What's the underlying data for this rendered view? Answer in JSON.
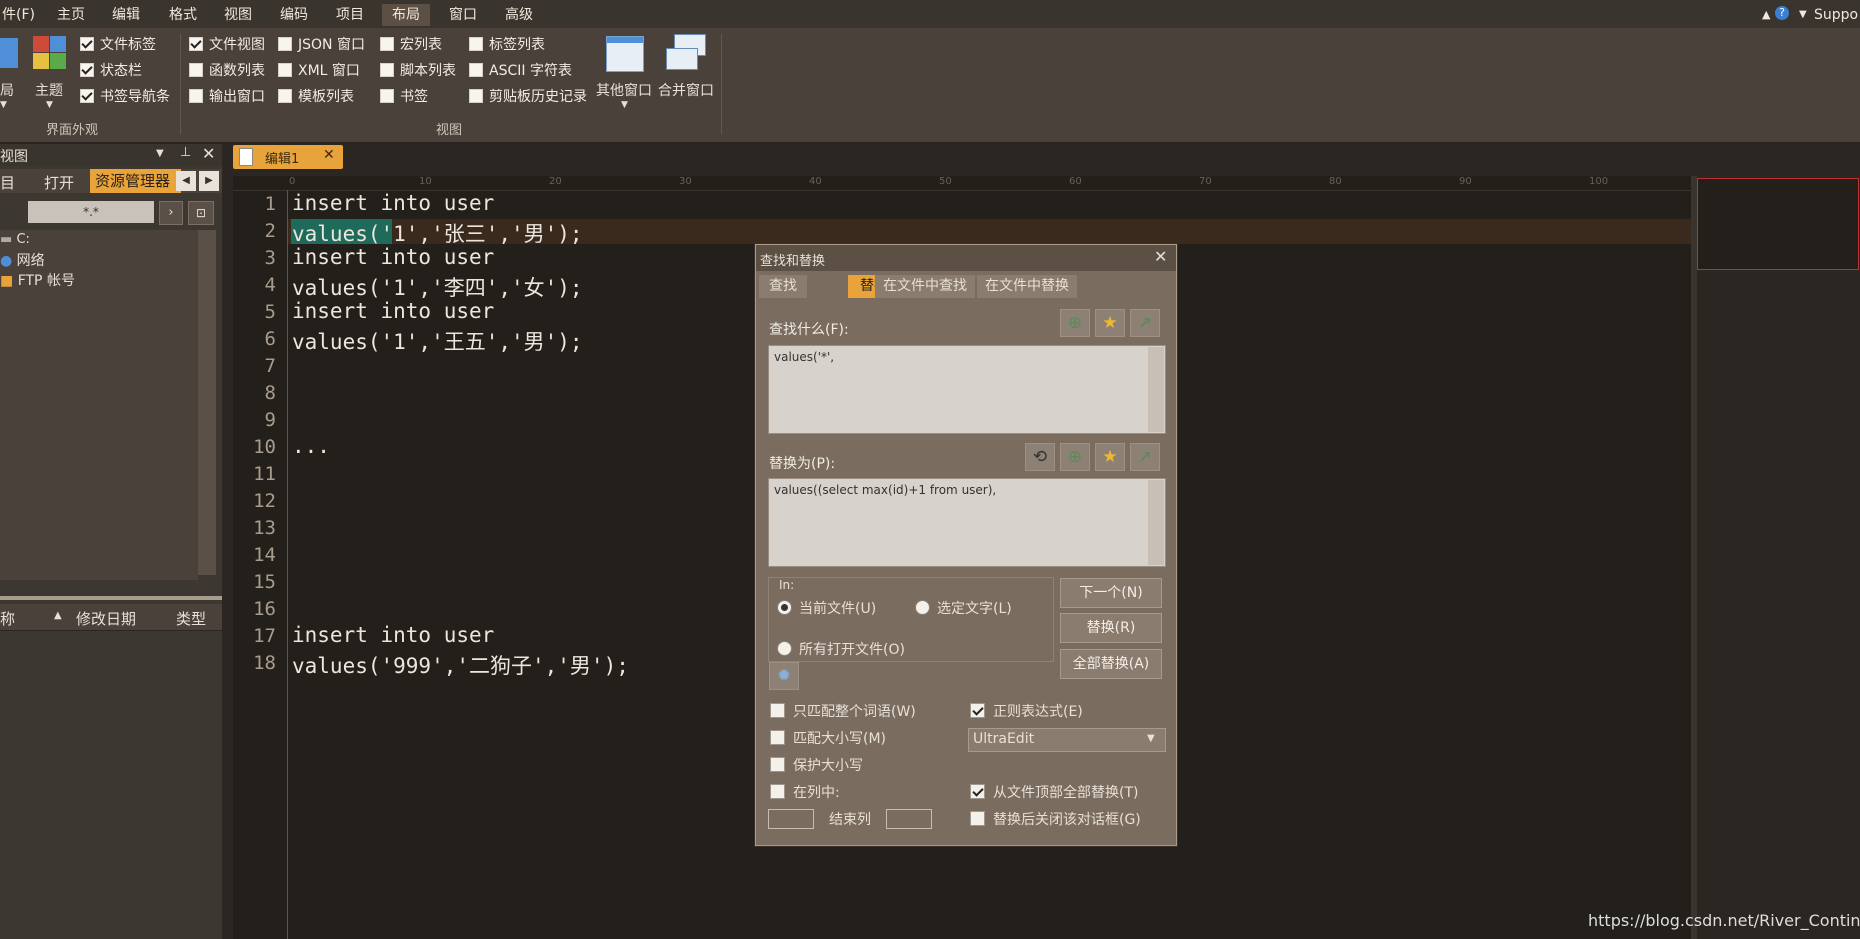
{
  "menubar": {
    "file_fragment": "件(F)",
    "items": [
      "主页",
      "编辑",
      "格式",
      "视图",
      "编码",
      "项目",
      "布局",
      "窗口",
      "高级"
    ],
    "active": "布局",
    "support_label": "Suppo"
  },
  "ribbon": {
    "layout_fragment": "局",
    "theme_label": "主题",
    "appearance_group": {
      "label": "界面外观",
      "checks": [
        {
          "label": "文件标签",
          "checked": true
        },
        {
          "label": "状态栏",
          "checked": true
        },
        {
          "label": "书签导航条",
          "checked": true
        }
      ]
    },
    "view_group": {
      "label": "视图",
      "col1": [
        {
          "label": "文件视图",
          "checked": true
        },
        {
          "label": "函数列表",
          "checked": false
        },
        {
          "label": "输出窗口",
          "checked": false
        }
      ],
      "col2": [
        {
          "label": "JSON 窗口",
          "checked": false
        },
        {
          "label": "XML 窗口",
          "checked": false
        },
        {
          "label": "模板列表",
          "checked": false
        }
      ],
      "col3": [
        {
          "label": "宏列表",
          "checked": false
        },
        {
          "label": "脚本列表",
          "checked": false
        },
        {
          "label": "书签",
          "checked": false
        }
      ],
      "col4": [
        {
          "label": "标签列表",
          "checked": false
        },
        {
          "label": "ASCII 字符表",
          "checked": false
        },
        {
          "label": "剪贴板历史记录",
          "checked": false
        }
      ],
      "other_window": "其他窗口",
      "merge_window": "合并窗口"
    }
  },
  "leftpanel": {
    "title": "视图",
    "tabs": [
      "目",
      "打开",
      "资源管理器"
    ],
    "filter": "*.*",
    "tree": [
      "C:",
      "网络",
      "FTP 帐号"
    ],
    "columns": [
      "称",
      "修改日期",
      "类型"
    ]
  },
  "editor": {
    "tab_label": "编辑1",
    "ruler_marks": [
      "0",
      "10",
      "20",
      "30",
      "40",
      "50",
      "60",
      "70",
      "80",
      "90",
      "100"
    ],
    "lines": [
      {
        "n": "1",
        "text": "insert into user"
      },
      {
        "n": "2",
        "text": "values('1','张三','男');"
      },
      {
        "n": "3",
        "text": "insert into user"
      },
      {
        "n": "4",
        "text": "values('1','李四','女');"
      },
      {
        "n": "5",
        "text": "insert into user"
      },
      {
        "n": "6",
        "text": "values('1','王五','男');"
      },
      {
        "n": "7",
        "text": ""
      },
      {
        "n": "8",
        "text": ""
      },
      {
        "n": "9",
        "text": ""
      },
      {
        "n": "10",
        "text": "..."
      },
      {
        "n": "11",
        "text": ""
      },
      {
        "n": "12",
        "text": ""
      },
      {
        "n": "13",
        "text": ""
      },
      {
        "n": "14",
        "text": ""
      },
      {
        "n": "15",
        "text": ""
      },
      {
        "n": "16",
        "text": ""
      },
      {
        "n": "17",
        "text": "insert into user"
      },
      {
        "n": "18",
        "text": "values('999','二狗子','男');"
      }
    ]
  },
  "dialog": {
    "title": "查找和替换",
    "tabs": [
      "查找",
      "替换",
      "在文件中查找",
      "在文件中替换"
    ],
    "active_tab": "替换",
    "find_label": "查找什么(F):",
    "find_value": "values('*',",
    "replace_label": "替换为(P):",
    "replace_value": "values((select max(id)+1 from user),",
    "in_label": "In:",
    "scope": {
      "current_file": "当前文件(U)",
      "selected_text": "选定文字(L)",
      "all_open": "所有打开文件(O)"
    },
    "buttons": {
      "next": "下一个(N)",
      "replace": "替换(R)",
      "replace_all": "全部替换(A)"
    },
    "options": {
      "whole_word": "只匹配整个词语(W)",
      "match_case": "匹配大小写(M)",
      "preserve_case": "保护大小写",
      "in_column": "在列中:",
      "end_column": "结束列",
      "regex": "正则表达式(E)",
      "regex_engine": "UltraEdit",
      "from_top": "从文件顶部全部替换(T)",
      "close_after": "替换后关闭该对话框(G)"
    }
  },
  "watermark": "https://blog.csdn.net/River_Continent",
  "colors": {
    "accent": "#e8a33a",
    "selection": "#1e6b5c"
  }
}
